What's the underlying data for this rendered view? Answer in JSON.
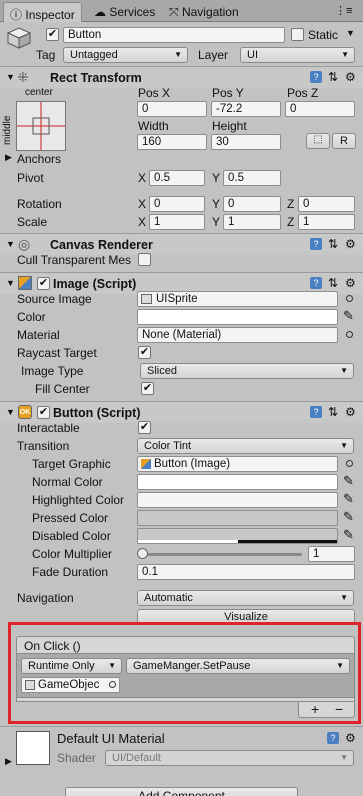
{
  "tabs": [
    {
      "label": "Inspector",
      "icon": "info-icon"
    },
    {
      "label": "Services",
      "icon": "cloud-icon"
    },
    {
      "label": "Navigation",
      "icon": "navigation-icon"
    }
  ],
  "object": {
    "name": "Button",
    "static_label": "Static",
    "tag_label": "Tag",
    "tag_value": "Untagged",
    "layer_label": "Layer",
    "layer_value": "UI"
  },
  "rect_transform": {
    "title": "Rect Transform",
    "anchor_h": "center",
    "anchor_v": "middle",
    "pos_x_label": "Pos X",
    "pos_y_label": "Pos Y",
    "pos_z_label": "Pos Z",
    "pos_x": "0",
    "pos_y": "-72.2",
    "pos_z": "0",
    "width_label": "Width",
    "height_label": "Height",
    "width": "160",
    "height": "30",
    "r_label": "R",
    "anchors_label": "Anchors",
    "pivot_label": "Pivot",
    "pivot_x": "0.5",
    "pivot_y": "0.5",
    "rotation_label": "Rotation",
    "rot_x": "0",
    "rot_y": "0",
    "rot_z": "0",
    "scale_label": "Scale",
    "scale_x": "1",
    "scale_y": "1",
    "scale_z": "1",
    "x": "X",
    "y": "Y",
    "z": "Z"
  },
  "canvas_renderer": {
    "title": "Canvas Renderer",
    "cull_label": "Cull Transparent Mes"
  },
  "image": {
    "title": "Image (Script)",
    "source_image_label": "Source Image",
    "source_image": "UISprite",
    "color_label": "Color",
    "material_label": "Material",
    "material": "None (Material)",
    "raycast_label": "Raycast Target",
    "image_type_label": "Image Type",
    "image_type": "Sliced",
    "fill_center_label": "Fill Center"
  },
  "button": {
    "title": "Button (Script)",
    "interactable_label": "Interactable",
    "transition_label": "Transition",
    "transition": "Color Tint",
    "target_graphic_label": "Target Graphic",
    "target_graphic": "Button (Image)",
    "normal_label": "Normal Color",
    "highlighted_label": "Highlighted Color",
    "pressed_label": "Pressed Color",
    "disabled_label": "Disabled Color",
    "multiplier_label": "Color Multiplier",
    "multiplier": "1",
    "fade_label": "Fade Duration",
    "fade": "0.1",
    "navigation_label": "Navigation",
    "navigation": "Automatic",
    "visualize_label": "Visualize",
    "onclick_label": "On Click ()",
    "runtime": "Runtime Only",
    "function": "GameManger.SetPause",
    "object": "GameObjec",
    "plus": "+",
    "minus": "−"
  },
  "material": {
    "title": "Default UI Material",
    "shader_label": "Shader",
    "shader": "UI/Default"
  },
  "add_component": "Add Component",
  "colors": {
    "highlight_box": "#e0222a",
    "accent": "#4a7fc0"
  }
}
